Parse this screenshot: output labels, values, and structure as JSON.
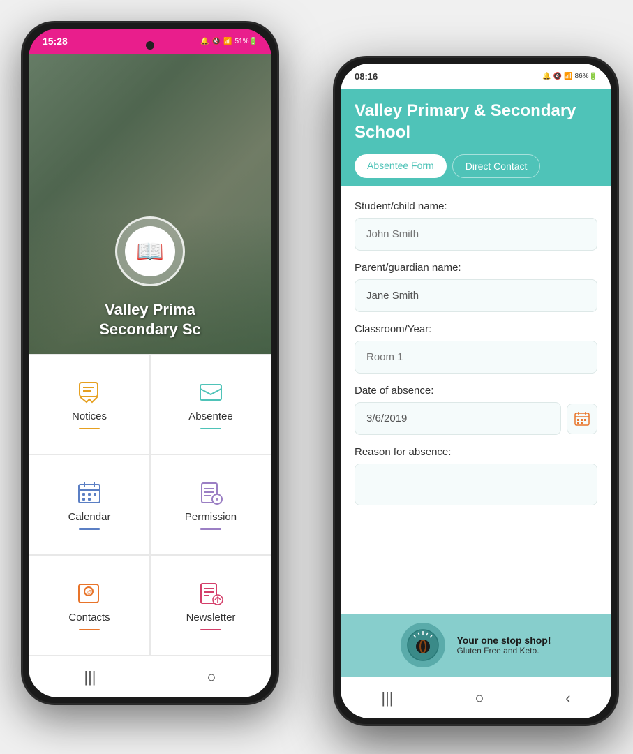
{
  "phone1": {
    "statusBar": {
      "time": "15:28",
      "icons": "🔔🔇📶 51%🔋"
    },
    "hero": {
      "schoolName": "Valley Prima\nSecondary Sc"
    },
    "menu": [
      {
        "id": "notices",
        "label": "Notices",
        "icon": "💬",
        "color": "#e6a020",
        "underlineColor": "#e6a020"
      },
      {
        "id": "absentee",
        "label": "Absentee",
        "icon": "✉️",
        "color": "#4fc3b8",
        "underlineColor": "#4fc3b8"
      },
      {
        "id": "calendar",
        "label": "Calendar",
        "icon": "📅",
        "color": "#5b7fc4",
        "underlineColor": "#5b7fc4"
      },
      {
        "id": "permissions",
        "label": "Permission",
        "icon": "📋",
        "color": "#9b7fc4",
        "underlineColor": "#9b7fc4"
      },
      {
        "id": "contacts",
        "label": "Contacts",
        "icon": "@",
        "color": "#e8742a",
        "underlineColor": "#e8742a"
      },
      {
        "id": "newsletter",
        "label": "Newsletter",
        "icon": "📝",
        "color": "#d43f6a",
        "underlineColor": "#d43f6a"
      }
    ],
    "bottomNav": [
      "|||",
      "○"
    ]
  },
  "phone2": {
    "statusBar": {
      "time": "08:16",
      "icons": "🔔🔇📶 86%🔋"
    },
    "header": {
      "schoolName": "Valley Primary & Secondary School"
    },
    "tabs": [
      {
        "id": "absentee",
        "label": "Absentee Form",
        "active": true
      },
      {
        "id": "direct",
        "label": "Direct Contact",
        "active": false
      }
    ],
    "form": {
      "fields": [
        {
          "id": "student-name",
          "label": "Student/child name:",
          "placeholder": "John Smith",
          "value": ""
        },
        {
          "id": "parent-name",
          "label": "Parent/guardian name:",
          "placeholder": "Jane Smith",
          "value": "Jane Smith"
        },
        {
          "id": "classroom",
          "label": "Classroom/Year:",
          "placeholder": "Room 1",
          "value": ""
        },
        {
          "id": "date-absence",
          "label": "Date of absence:",
          "placeholder": "3/6/2019",
          "value": "3/6/2019",
          "hasCalendar": true
        },
        {
          "id": "reason",
          "label": "Reason for absence:",
          "placeholder": "",
          "value": "",
          "multiline": true
        }
      ]
    },
    "ad": {
      "title": "Your one stop shop!",
      "subtitle": "Gluten Free and Keto.",
      "logoEmoji": "☕"
    },
    "bottomNav": [
      "|||",
      "○",
      "<"
    ]
  }
}
